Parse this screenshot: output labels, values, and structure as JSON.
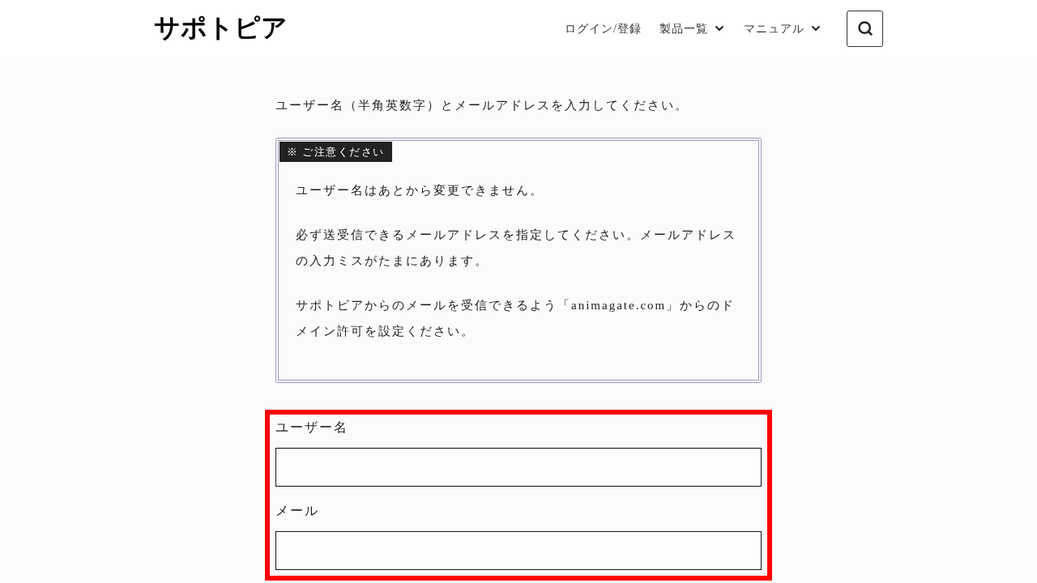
{
  "header": {
    "logo": "サポトピア",
    "nav": [
      {
        "label": "ログイン/登録",
        "has_menu": false
      },
      {
        "label": "製品一覧",
        "has_menu": true
      },
      {
        "label": "マニュアル",
        "has_menu": true
      }
    ]
  },
  "intro": "ユーザー名（半角英数字）とメールアドレスを入力してください。",
  "notice": {
    "label": "※ ご注意ください",
    "paragraphs": [
      "ユーザー名はあとから変更できません。",
      "必ず送受信できるメールアドレスを指定してください。メールアドレスの入力ミスがたまにあります。",
      "サポトピアからのメールを受信できるよう「animagate.com」からのドメイン許可を設定ください。"
    ]
  },
  "form": {
    "highlighted": true,
    "fields": [
      {
        "label": "ユーザー名"
      },
      {
        "label": "メール"
      }
    ]
  }
}
